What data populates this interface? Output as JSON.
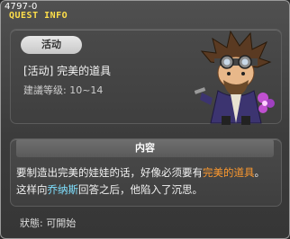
{
  "window": {
    "id_text": "4797-0",
    "title": "QUEST INFO"
  },
  "quest": {
    "category_badge": "活动",
    "name": "[活动] 完美的道具",
    "level_req": "建議等级: 10~14"
  },
  "content": {
    "header": "内容",
    "desc_part1": "要制造出完美的娃娃的话，好像必须要有",
    "desc_highlight_item": "完美的道具",
    "desc_part2": "。这样向",
    "desc_highlight_npc": "乔纳斯",
    "desc_part3": "回答之后，他陷入了沉思。"
  },
  "status": {
    "text": "狀態:  可開始"
  },
  "colors": {
    "title": "#ffdf4a",
    "item_highlight": "#ff9a2e",
    "npc_highlight": "#7fe0ff"
  },
  "icons": {
    "npc_portrait": "goggles-inventor-npc"
  }
}
